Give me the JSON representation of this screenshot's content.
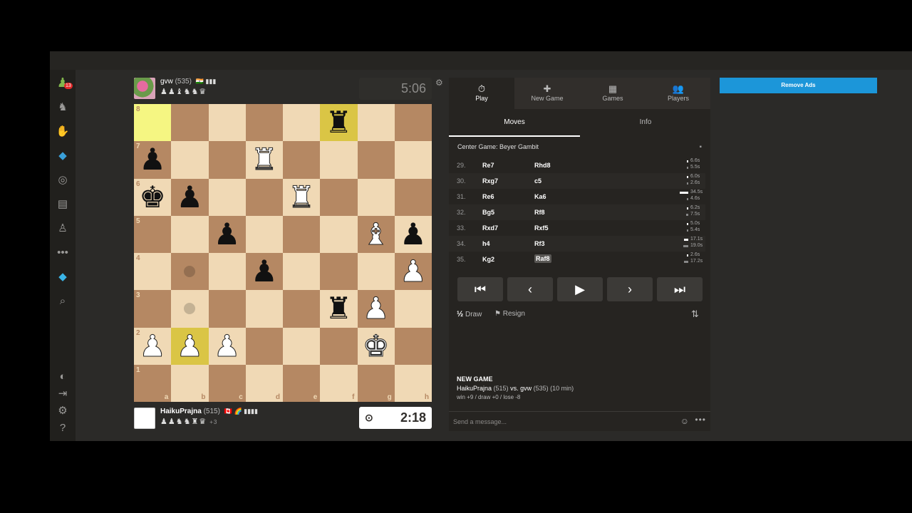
{
  "sidebar": {
    "items": [
      {
        "icon": "pawn-logo-icon",
        "glyph": "♟",
        "badge": "13"
      },
      {
        "icon": "puzzle-icon",
        "glyph": "♞"
      },
      {
        "icon": "lessons-icon",
        "glyph": "✋"
      },
      {
        "icon": "train-icon",
        "glyph": "◆"
      },
      {
        "icon": "watch-icon",
        "glyph": "◎"
      },
      {
        "icon": "news-icon",
        "glyph": "▤"
      },
      {
        "icon": "social-icon",
        "glyph": "♙"
      },
      {
        "icon": "more-icon",
        "glyph": "•••"
      },
      {
        "icon": "diamond-icon",
        "glyph": "◆"
      },
      {
        "icon": "search-icon",
        "glyph": "⌕"
      }
    ],
    "bottom": [
      {
        "icon": "contrast-icon",
        "glyph": "◐"
      },
      {
        "icon": "collapse-icon",
        "glyph": "⇥"
      },
      {
        "icon": "settings-icon",
        "glyph": "⚙"
      },
      {
        "icon": "help-icon",
        "glyph": "?"
      }
    ]
  },
  "top_player": {
    "name": "gvw",
    "rating": "(535)",
    "flags": "🇮🇳 ▮▮▮",
    "captured": "♟♟♝♞♞♛",
    "clock": "5:06"
  },
  "bottom_player": {
    "name": "HaikuPrajna",
    "rating": "(515)",
    "flags": "🇨🇦 🌈 ▮▮▮▮",
    "captured": "♟♟♞♞♜♛",
    "advantage": "+3",
    "clock": "2:18",
    "clock_icon": "timer-icon"
  },
  "board": {
    "ranks": [
      "8",
      "7",
      "6",
      "5",
      "4",
      "3",
      "2",
      "1"
    ],
    "files": [
      "a",
      "b",
      "c",
      "d",
      "e",
      "f",
      "g",
      "h"
    ],
    "highlights": [
      "a8",
      "f8",
      "b2"
    ],
    "move_dots": [
      "b4",
      "b3"
    ],
    "pieces": [
      {
        "sq": "f8",
        "p": "♜",
        "c": "b"
      },
      {
        "sq": "a7",
        "p": "♟",
        "c": "b"
      },
      {
        "sq": "d7",
        "p": "♜",
        "c": "w"
      },
      {
        "sq": "a6",
        "p": "♚",
        "c": "b"
      },
      {
        "sq": "b6",
        "p": "♟",
        "c": "b"
      },
      {
        "sq": "e6",
        "p": "♜",
        "c": "w"
      },
      {
        "sq": "c5",
        "p": "♟",
        "c": "b"
      },
      {
        "sq": "g5",
        "p": "♝",
        "c": "w"
      },
      {
        "sq": "h5",
        "p": "♟",
        "c": "b"
      },
      {
        "sq": "d4",
        "p": "♟",
        "c": "b"
      },
      {
        "sq": "h4",
        "p": "♟",
        "c": "w"
      },
      {
        "sq": "f3",
        "p": "♜",
        "c": "b"
      },
      {
        "sq": "g3",
        "p": "♟",
        "c": "w"
      },
      {
        "sq": "a2",
        "p": "♟",
        "c": "w"
      },
      {
        "sq": "b2",
        "p": "♟",
        "c": "w"
      },
      {
        "sq": "c2",
        "p": "♟",
        "c": "w"
      },
      {
        "sq": "g2",
        "p": "♚",
        "c": "w"
      }
    ]
  },
  "panel": {
    "tabs": [
      {
        "label": "Play",
        "glyph": "⏱",
        "icon": "stopwatch-icon"
      },
      {
        "label": "New Game",
        "glyph": "✚",
        "icon": "new-game-icon"
      },
      {
        "label": "Games",
        "glyph": "▦",
        "icon": "games-icon"
      },
      {
        "label": "Players",
        "glyph": "👥",
        "icon": "players-icon"
      }
    ],
    "subtabs": [
      "Moves",
      "Info"
    ],
    "opening": "Center Game: Beyer Gambit",
    "moves": [
      {
        "num": "29.",
        "w": "Re7",
        "b": "Rhd8",
        "wt": "6.6s",
        "bt": "5.5s",
        "wf": 0.04,
        "bf": 0.03
      },
      {
        "num": "30.",
        "w": "Rxg7",
        "b": "c5",
        "wt": "6.0s",
        "bt": "2.6s",
        "wf": 0.04,
        "bf": 0.02
      },
      {
        "num": "31.",
        "w": "Re6",
        "b": "Ka6",
        "wt": "34.5s",
        "bt": "4.6s",
        "wf": 0.2,
        "bf": 0.03
      },
      {
        "num": "32.",
        "w": "Bg5",
        "b": "Rf8",
        "wt": "6.2s",
        "bt": "7.5s",
        "wf": 0.04,
        "bf": 0.05
      },
      {
        "num": "33.",
        "w": "Rxd7",
        "b": "Rxf5",
        "wt": "5.0s",
        "bt": "5.4s",
        "wf": 0.03,
        "bf": 0.03
      },
      {
        "num": "34.",
        "w": "h4",
        "b": "Rf3",
        "wt": "17.1s",
        "bt": "19.0s",
        "wf": 0.1,
        "bf": 0.11
      },
      {
        "num": "35.",
        "w": "Kg2",
        "b": "Raf8",
        "wt": "2.6s",
        "bt": "17.2s",
        "wf": 0.02,
        "bf": 0.1
      }
    ],
    "nav": [
      "⏮",
      "‹",
      "▶",
      "›",
      "⏭"
    ],
    "draw_label": "Draw",
    "draw_glyph": "½",
    "resign_label": "Resign",
    "flip_glyph": "⇅",
    "new_game": {
      "title": "NEW GAME",
      "white": "HaikuPrajna",
      "white_rating": "(515)",
      "vs": "vs.",
      "black": "gvw",
      "black_rating": "(535)",
      "time": "(10 min)",
      "result": "win +9 / draw +0 / lose -8"
    },
    "message_placeholder": "Send a message..."
  },
  "ads": {
    "label": "Remove Ads"
  },
  "colors": {
    "light": "#f0d9b5",
    "dark": "#b58863",
    "highlight": "#f5f682",
    "accent": "#1c96d9"
  }
}
